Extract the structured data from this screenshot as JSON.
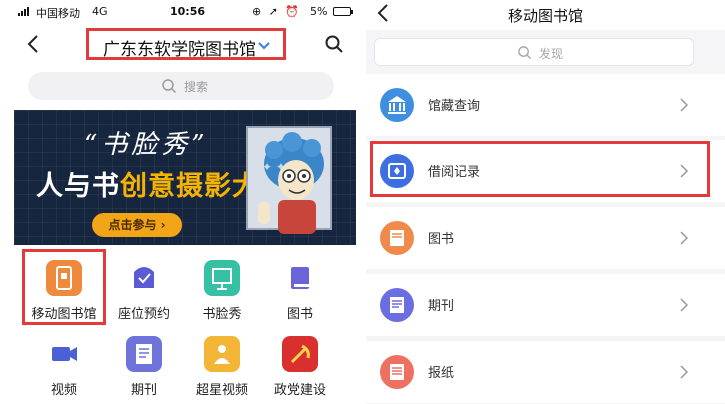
{
  "left": {
    "status": {
      "carrier": "中国移动",
      "network": "4G",
      "time": "10:56",
      "battery": "5%"
    },
    "nav": {
      "library": "广东东软学院图书馆"
    },
    "search": {
      "placeholder": "搜索"
    },
    "banner": {
      "calligraphy": "“书脸秀”",
      "headline_a": "人与书",
      "headline_b": "创意摄影大赛",
      "cta": "点击参与 ›"
    },
    "grid": [
      {
        "label": "移动图书馆",
        "icon": "mobile-library-icon",
        "color": "#ef8a3c"
      },
      {
        "label": "座位预约",
        "icon": "seat-reservation-icon",
        "color": "#5b5bd6"
      },
      {
        "label": "书脸秀",
        "icon": "book-face-show-icon",
        "color": "#36c1a4"
      },
      {
        "label": "图书",
        "icon": "book-icon",
        "color": "#6b63d9"
      },
      {
        "label": "视频",
        "icon": "video-icon",
        "color": "#4b5fd6"
      },
      {
        "label": "期刊",
        "icon": "journal-icon",
        "color": "#6e72d9"
      },
      {
        "label": "超星视频",
        "icon": "chaoxing-video-icon",
        "color": "#f2b535"
      },
      {
        "label": "政党建设",
        "icon": "party-building-icon",
        "color": "#d9302f"
      }
    ]
  },
  "right": {
    "nav": {
      "title": "移动图书馆"
    },
    "search": {
      "placeholder": "发现"
    },
    "items": [
      {
        "label": "馆藏查询",
        "icon": "library-collection-icon",
        "color": "#3e8fe0"
      },
      {
        "label": "借阅记录",
        "icon": "borrow-record-icon",
        "color": "#3e6fe0"
      },
      {
        "label": "图书",
        "icon": "book-icon",
        "color": "#f08a4a"
      },
      {
        "label": "期刊",
        "icon": "journal-icon",
        "color": "#6a6ee0"
      },
      {
        "label": "报纸",
        "icon": "newspaper-icon",
        "color": "#ee7060"
      }
    ]
  }
}
